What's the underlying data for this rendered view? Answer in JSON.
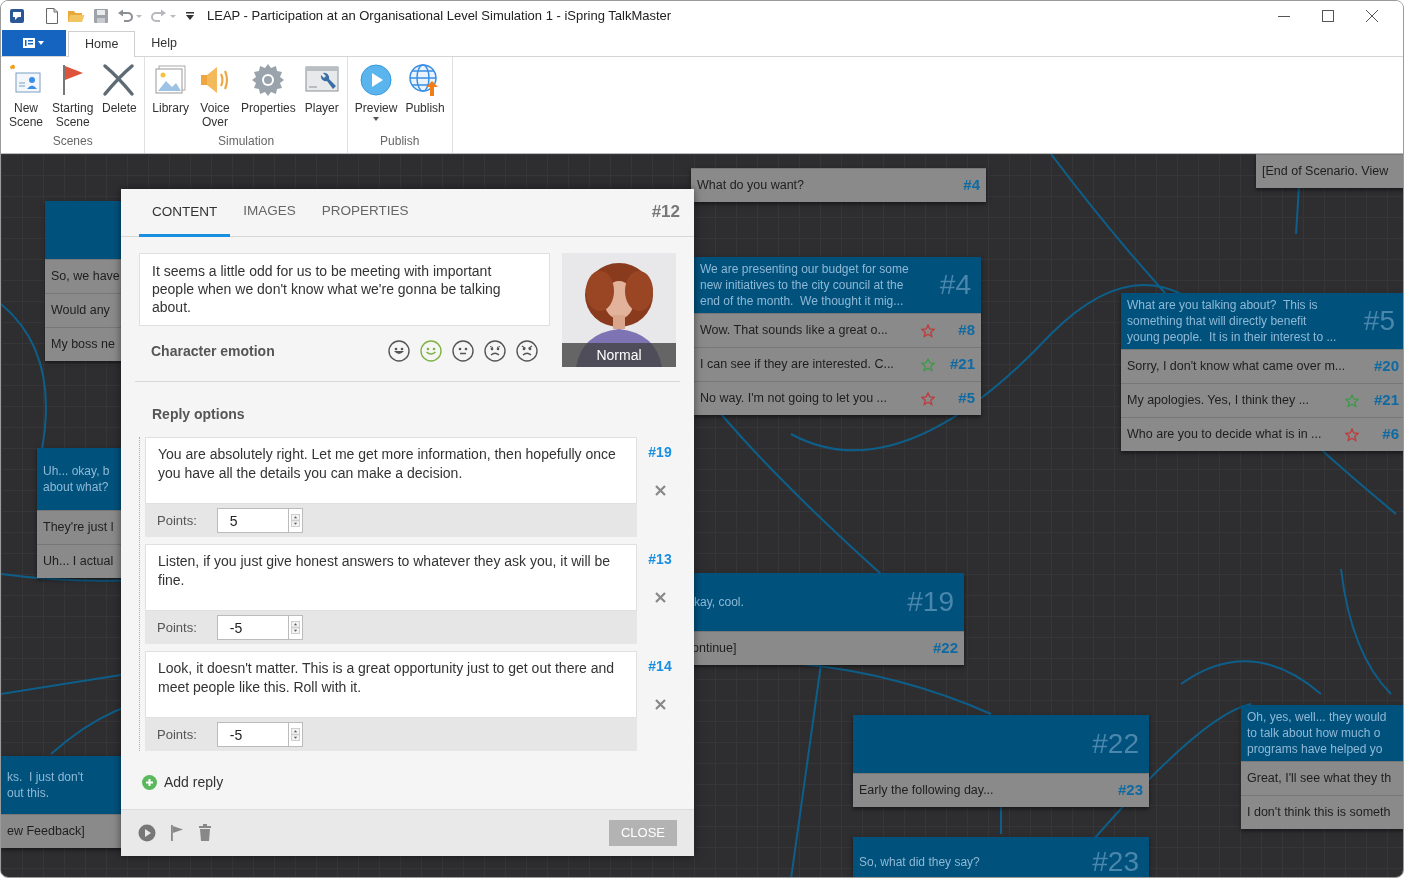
{
  "window": {
    "title": "LEAP -  Participation at an Organisational Level Simulation 1 - iSpring TalkMaster"
  },
  "ribbon": {
    "tabs": [
      {
        "label": "Home",
        "selected": true
      },
      {
        "label": "Help",
        "selected": false
      }
    ],
    "groups": [
      {
        "label": "Scenes",
        "buttons": [
          {
            "label": "New\nScene"
          },
          {
            "label": "Starting\nScene"
          },
          {
            "label": "Delete"
          }
        ]
      },
      {
        "label": "Simulation",
        "buttons": [
          {
            "label": "Library"
          },
          {
            "label": "Voice\nOver"
          },
          {
            "label": "Properties"
          },
          {
            "label": "Player"
          }
        ]
      },
      {
        "label": "Publish",
        "buttons": [
          {
            "label": "Preview",
            "dropdown": true
          },
          {
            "label": "Publish",
            "dropdown": false
          }
        ]
      }
    ]
  },
  "canvas": {
    "nodes": [
      {
        "kind": "scene",
        "rows": [
          {
            "text": "So, we have"
          },
          {
            "text": "Would any"
          },
          {
            "text": "My boss ne"
          }
        ]
      },
      {
        "kind": "scene",
        "header": "Uh... okay, b\nabout what?",
        "rows": [
          {
            "text": "They're just l"
          },
          {
            "text": "Uh... I actual"
          }
        ]
      },
      {
        "kind": "scene",
        "header": "ks.  I just don't\nout this.",
        "rows": [
          {
            "text": "ew Feedback]"
          }
        ]
      },
      {
        "kind": "rows",
        "rows": [
          {
            "text": "What do you want?",
            "target": "#4"
          }
        ]
      },
      {
        "kind": "scene",
        "header": "We are presenting our budget for some\nnew initiatives to the city council at the\nend of the month.  We thought it mig...",
        "number": "#4",
        "rows": [
          {
            "text": "Wow.  That sounds like a great o...",
            "color": "#c0393b",
            "target": "#8"
          },
          {
            "text": "I can see if they are interested.  C...",
            "color": "#3d9a48",
            "target": "#21"
          },
          {
            "text": "No way.  I'm not going to let you ...",
            "color": "#c0393b",
            "target": "#5"
          }
        ]
      },
      {
        "kind": "rows",
        "rows": [
          {
            "text": "[End of Scenario.  View"
          }
        ]
      },
      {
        "kind": "scene",
        "header": "What are you talking about?  This is\nsomething that will directly benefit\nyoung people.  It is in their interest to ...",
        "number": "#5",
        "rows": [
          {
            "text": "Sorry, I don't know what came over m...",
            "target": "#20"
          },
          {
            "text": "My apologies.  Yes, I think they ...",
            "color": "#3d9a48",
            "target": "#21"
          },
          {
            "text": "Who are you to decide what is in ...",
            "color": "#c0393b",
            "target": "#6"
          }
        ]
      },
      {
        "kind": "scene",
        "header": "kay, cool.",
        "number": "#19",
        "rows": [
          {
            "text": "ontinue]",
            "target": "#22"
          }
        ]
      },
      {
        "kind": "scene",
        "number": "#22",
        "rows": [
          {
            "text": "Early the following day...",
            "target": "#23"
          }
        ]
      },
      {
        "kind": "scene",
        "header": "So, what did they say?",
        "number": "#23"
      },
      {
        "kind": "scene",
        "header": "Oh, yes, well... they would\nto talk about how much o\nprograms have helped yo",
        "rows": [
          {
            "text": "Great, I'll see what they th"
          },
          {
            "text": "I don't think this is someth"
          }
        ]
      }
    ]
  },
  "dialog": {
    "tabs": [
      {
        "label": "CONTENT",
        "selected": true
      },
      {
        "label": "IMAGES",
        "selected": false
      },
      {
        "label": "PROPERTIES",
        "selected": false
      }
    ],
    "scene_number": "#12",
    "speech": "It seems a little odd for us to be meeting with important people when we don't know what we're gonna be talking about.",
    "emotion_label": "Character emotion",
    "emotions": [
      {
        "kind": "laugh",
        "selected": false
      },
      {
        "kind": "smile",
        "selected": true
      },
      {
        "kind": "neutral",
        "selected": false
      },
      {
        "kind": "sad",
        "selected": false
      },
      {
        "kind": "angry",
        "selected": false
      }
    ],
    "portrait_caption": "Normal",
    "replies_label": "Reply options",
    "replies": [
      {
        "text": "You are absolutely right.  Let me get more information, then hopefully once you have all the details you can make a decision.",
        "points_label": "Points:",
        "points": "5",
        "target": "#19"
      },
      {
        "text": "Listen, if you just give honest answers to whatever they ask you, it will be fine.",
        "points_label": "Points:",
        "points": "-5",
        "target": "#13"
      },
      {
        "text": "Look, it doesn't matter.  This is a great opportunity just to get out there and meet people like this.  Roll with it.",
        "points_label": "Points:",
        "points": "-5",
        "target": "#14"
      }
    ],
    "add_reply": "Add reply",
    "close_button": "CLOSE"
  }
}
